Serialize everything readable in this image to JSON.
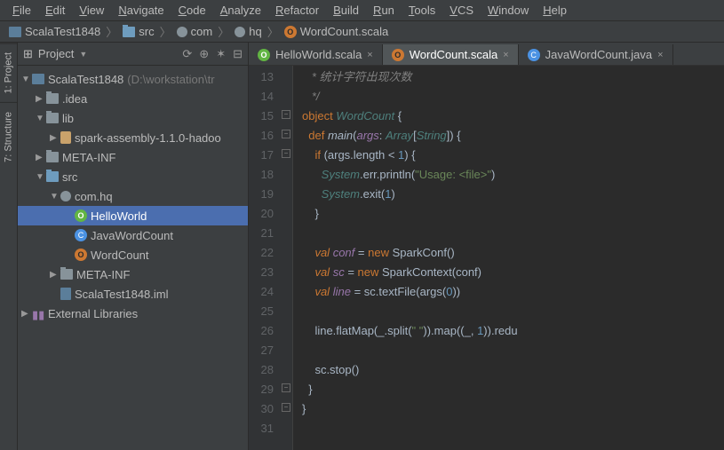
{
  "menu": [
    "File",
    "Edit",
    "View",
    "Navigate",
    "Code",
    "Analyze",
    "Refactor",
    "Build",
    "Run",
    "Tools",
    "VCS",
    "Window",
    "Help"
  ],
  "breadcrumb": [
    {
      "icon": "root",
      "label": "ScalaTest1848"
    },
    {
      "icon": "folder-blue",
      "label": "src"
    },
    {
      "icon": "pkg",
      "label": "com"
    },
    {
      "icon": "pkg",
      "label": "hq"
    },
    {
      "icon": "scala",
      "label": "WordCount.scala"
    }
  ],
  "sidetabs": [
    "1: Project",
    "7: Structure"
  ],
  "project_header": {
    "label": "Project",
    "icons": [
      "⟳",
      "⊕",
      "✶",
      "⊟"
    ]
  },
  "tree": [
    {
      "d": 0,
      "a": "▼",
      "i": "root",
      "t": "ScalaTest1848",
      "p": "(D:\\workstation\\tr"
    },
    {
      "d": 1,
      "a": "▶",
      "i": "folder",
      "t": ".idea"
    },
    {
      "d": 1,
      "a": "▼",
      "i": "folder",
      "t": "lib"
    },
    {
      "d": 2,
      "a": "▶",
      "i": "jar",
      "t": "spark-assembly-1.1.0-hadoo"
    },
    {
      "d": 1,
      "a": "▶",
      "i": "folder",
      "t": "META-INF"
    },
    {
      "d": 1,
      "a": "▼",
      "i": "folder-blue",
      "t": "src"
    },
    {
      "d": 2,
      "a": "▼",
      "i": "pkg",
      "t": "com.hq"
    },
    {
      "d": 3,
      "a": "",
      "i": "scala-g",
      "t": "HelloWorld",
      "sel": true
    },
    {
      "d": 3,
      "a": "",
      "i": "java",
      "t": "JavaWordCount"
    },
    {
      "d": 3,
      "a": "",
      "i": "scala",
      "t": "WordCount"
    },
    {
      "d": 2,
      "a": "▶",
      "i": "folder",
      "t": "META-INF"
    },
    {
      "d": 2,
      "a": "",
      "i": "iml",
      "t": "ScalaTest1848.iml"
    },
    {
      "d": 0,
      "a": "▶",
      "i": "lib",
      "t": "External Libraries"
    }
  ],
  "tabs": [
    {
      "i": "scala-g",
      "label": "HelloWorld.scala",
      "active": false
    },
    {
      "i": "scala",
      "label": "WordCount.scala",
      "active": true
    },
    {
      "i": "java",
      "label": "JavaWordCount.java",
      "active": false
    }
  ],
  "code": {
    "start": 13,
    "lines": [
      {
        "t": "com",
        "s": "   * 统计字符出现次数"
      },
      {
        "t": "com",
        "s": "   */"
      },
      {
        "t": "raw",
        "s": "<span class='kw2'>object</span> <span class='cls'>WordCount</span> {"
      },
      {
        "t": "raw",
        "s": "  <span class='kw2'>def</span> <span class='fn'>main</span>(<span class='id'>args</span>: <span class='typ'>Array</span>[<span class='typ'>String</span>]) {"
      },
      {
        "t": "raw",
        "s": "    <span class='kw2'>if</span> (args.length &lt; <span class='num'>1</span>) {"
      },
      {
        "t": "raw",
        "s": "      <span class='typ'>System</span>.err.println(<span class='str'>\"Usage: &lt;file&gt;\"</span>)"
      },
      {
        "t": "raw",
        "s": "      <span class='typ'>System</span>.exit(<span class='num'>1</span>)"
      },
      {
        "t": "raw",
        "s": "    }"
      },
      {
        "t": "raw",
        "s": ""
      },
      {
        "t": "raw",
        "s": "    <span class='kw'>val</span> <span class='id'>conf</span> = <span class='kw2'>new</span> SparkConf()"
      },
      {
        "t": "raw",
        "s": "    <span class='kw'>val</span> <span class='id'>sc</span> = <span class='kw2'>new</span> SparkContext(conf)"
      },
      {
        "t": "raw",
        "s": "    <span class='kw'>val</span> <span class='id'>line</span> = sc.textFile(args(<span class='num'>0</span>))"
      },
      {
        "t": "raw",
        "s": ""
      },
      {
        "t": "raw",
        "s": "    line.flatMap(_.split(<span class='str'>\" \"</span>)).map((_, <span class='num'>1</span>)).redu"
      },
      {
        "t": "raw",
        "s": ""
      },
      {
        "t": "raw",
        "s": "    sc.stop()"
      },
      {
        "t": "raw",
        "s": "  }"
      },
      {
        "t": "raw",
        "s": "}"
      },
      {
        "t": "raw",
        "s": ""
      }
    ]
  }
}
